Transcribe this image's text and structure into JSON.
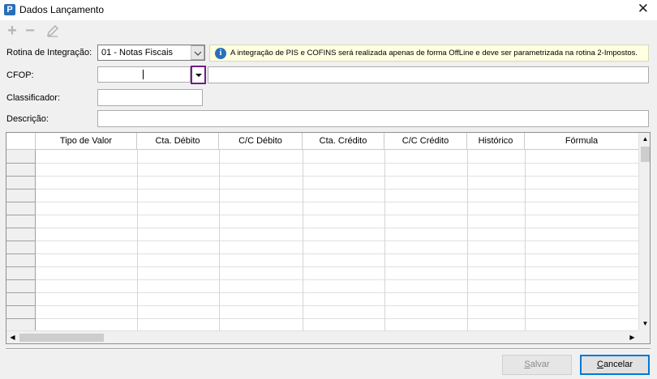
{
  "window": {
    "title": "Dados Lançamento",
    "app_icon_glyph": "P",
    "close_glyph": "✕"
  },
  "toolbar": {
    "add_glyph": "+",
    "remove_glyph": "−",
    "edit_icon": "pencil-icon"
  },
  "form": {
    "rotina_label": "Rotina de Integração:",
    "rotina_value": "01 - Notas Fiscais",
    "info_text": "A integração de PIS e COFINS será realizada apenas de forma OffLine e deve ser parametrizada na rotina 2-Impostos.",
    "cfop_label": "CFOP:",
    "cfop_value": "",
    "classificador_label": "Classificador:",
    "classificador_value": "",
    "descricao_label": "Descrição:",
    "descricao_value": ""
  },
  "grid": {
    "columns": [
      "Tipo de Valor",
      "Cta. Débito",
      "C/C Débito",
      "Cta. Crédito",
      "C/C Crédito",
      "Histórico",
      "Fórmula"
    ],
    "rows": []
  },
  "footer": {
    "salvar_first": "S",
    "salvar_rest": "alvar",
    "cancelar_first": "C",
    "cancelar_rest": "ancelar"
  },
  "colors": {
    "info_background": "#ffffe1",
    "highlight_border": "#6d1d8a",
    "default_button_border": "#0078d7"
  }
}
